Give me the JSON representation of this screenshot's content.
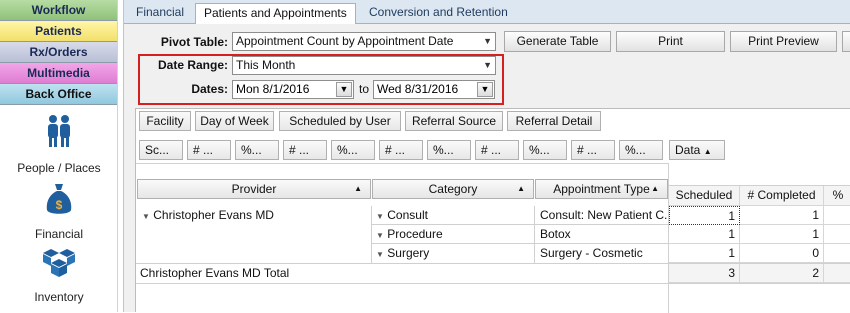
{
  "sidebar": {
    "nav_buttons": [
      {
        "label": "Workflow",
        "color": "#8fc27a"
      },
      {
        "label": "Patients",
        "color": "#f2e06a"
      },
      {
        "label": "Rx/Orders",
        "color": "#b9bfd6"
      },
      {
        "label": "Multimedia",
        "color": "#df7dd3"
      },
      {
        "label": "Back Office",
        "color": "#8fc8de"
      }
    ],
    "items": [
      {
        "label": "People / Places",
        "icon": "people-icon"
      },
      {
        "label": "Financial",
        "icon": "money-bag-icon"
      },
      {
        "label": "Inventory",
        "icon": "boxes-icon"
      }
    ]
  },
  "tabs": [
    {
      "label": "Financial"
    },
    {
      "label": "Patients and Appointments"
    },
    {
      "label": "Conversion and Retention"
    }
  ],
  "controls": {
    "pivot_label": "Pivot Table:",
    "pivot_value": "Appointment Count by Appointment Date",
    "generate_label": "Generate Table",
    "print_label": "Print",
    "print_preview_label": "Print Preview",
    "date_range_label": "Date Range:",
    "date_range_value": "This Month",
    "dates_label": "Dates:",
    "date_from": "Mon 8/1/2016",
    "to_label": "to",
    "date_to": "Wed 8/31/2016",
    "highlight_color": "#d42020"
  },
  "field_buttons": [
    {
      "label": "Facility"
    },
    {
      "label": "Day of Week"
    },
    {
      "label": "Scheduled by User"
    },
    {
      "label": "Referral Source"
    },
    {
      "label": "Referral Detail"
    }
  ],
  "filter_buttons": [
    {
      "label": "Sc..."
    },
    {
      "label": "# ..."
    },
    {
      "label": "%..."
    },
    {
      "label": "# ..."
    },
    {
      "label": "%..."
    },
    {
      "label": "# ..."
    },
    {
      "label": "%..."
    },
    {
      "label": "# ..."
    },
    {
      "label": "%..."
    },
    {
      "label": "# ..."
    },
    {
      "label": "%..."
    }
  ],
  "data_header": "Data",
  "row_headers": [
    {
      "label": "Provider"
    },
    {
      "label": "Category"
    },
    {
      "label": "Appointment Type"
    }
  ],
  "column_headers": [
    "Scheduled",
    "# Completed",
    "%"
  ],
  "rows": [
    {
      "provider": "Christopher Evans MD",
      "category": "Consult",
      "type": "Consult: New Patient C...",
      "scheduled": "1",
      "completed": "1"
    },
    {
      "provider": "",
      "category": "Procedure",
      "type": "Botox",
      "scheduled": "1",
      "completed": "1"
    },
    {
      "provider": "",
      "category": "Surgery",
      "type": "Surgery - Cosmetic",
      "scheduled": "1",
      "completed": "0"
    }
  ],
  "total": {
    "label": "Christopher Evans MD Total",
    "scheduled": "3",
    "completed": "2"
  }
}
